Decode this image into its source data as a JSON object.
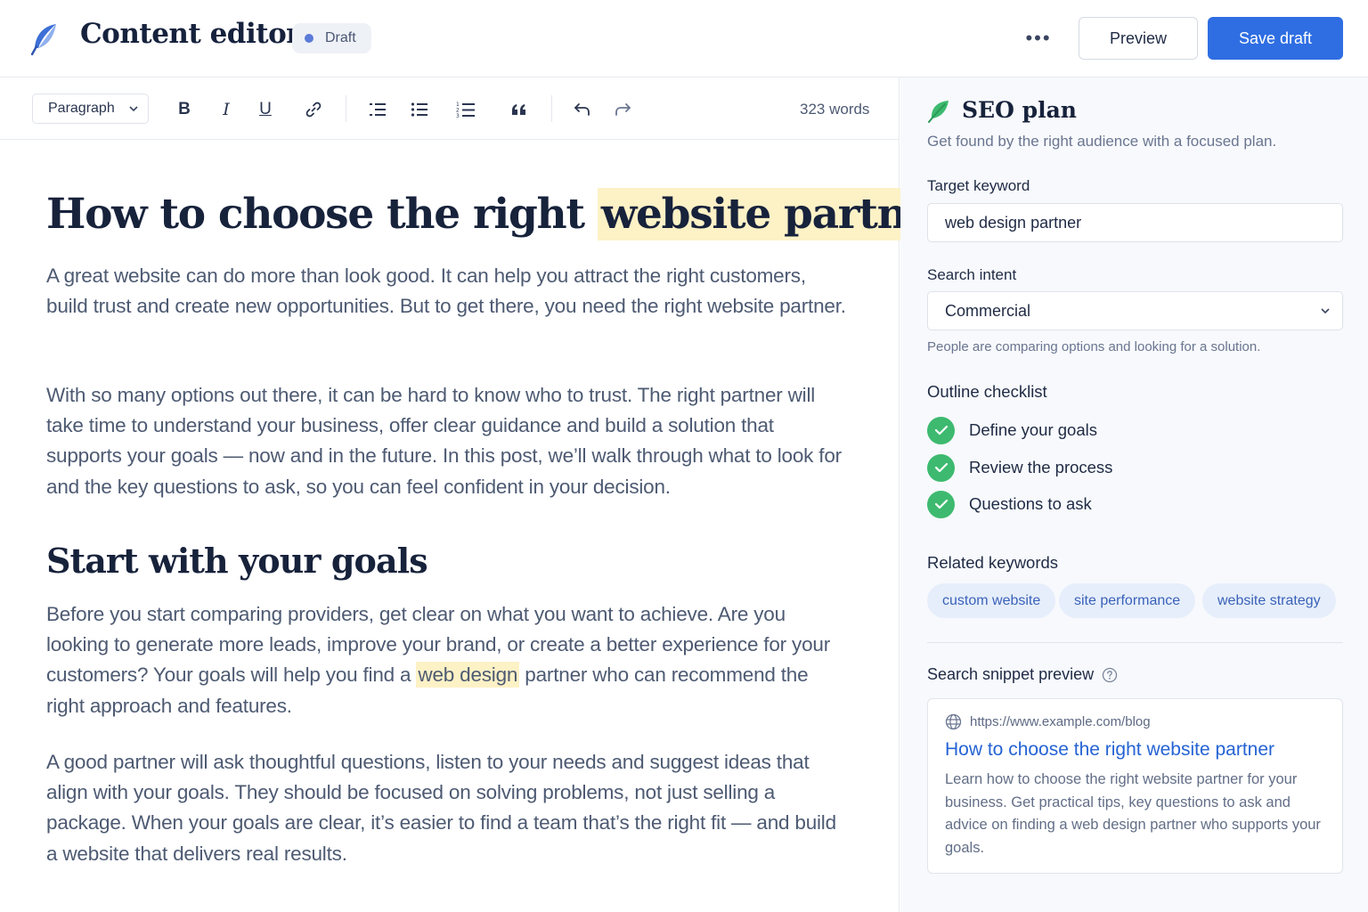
{
  "header": {
    "title": "Content editor",
    "status": "Draft",
    "more_label": "•••",
    "preview_label": "Preview",
    "save_label": "Save draft"
  },
  "toolbar": {
    "block_type": "Paragraph",
    "bold": "B",
    "italic": "I",
    "underline": "U",
    "word_count": "323 words"
  },
  "document": {
    "title_plain": "How to choose the right ",
    "title_highlight": "website partner",
    "p1": "A great website can do more than look good. It can help you attract the right customers, build trust and create new opportunities. But to get there, you need the right website partner.",
    "p2": "With so many options out there, it can be hard to know who to trust. The right partner will take time to understand your business, offer clear guidance and build a solution that supports your goals — now and in the future. In this post, we’ll walk through what to look for and the key questions to ask, so you can feel confident in your decision.",
    "h2": "Start with your goals",
    "p3_before": "Before you start comparing providers, get clear on what you want to achieve. Are you looking to generate more leads, improve your brand, or create a better experience for your customers? Your goals will help you find a ",
    "p3_highlight": "web design",
    "p3_after": " partner who can recommend the right approach and features.",
    "p4": "A good partner will ask thoughtful questions, listen to your needs and suggest ideas that align with your goals. They should be focused on solving problems, not just selling a package. When your goals are clear, it’s easier to find a team that’s the right fit — and build a website that delivers real results."
  },
  "seo": {
    "title": "SEO plan",
    "subtitle": "Get found by the right audience with a focused plan.",
    "keyword_label": "Target keyword",
    "keyword_value": "web design partner",
    "intent_label": "Search intent",
    "intent_value": "Commercial",
    "intent_hint": "People are comparing options and looking for a solution.",
    "checklist_label": "Outline checklist",
    "checklist": [
      "Define your goals",
      "Review the process",
      "Questions to ask"
    ],
    "related_label": "Related keywords",
    "related": [
      "custom website",
      "site performance",
      "website strategy"
    ],
    "snippet_label": "Search snippet preview",
    "snippet_url": "https://www.example.com/blog",
    "snippet_title": "How to choose the right website partner",
    "snippet_desc": "Learn how to choose the right website partner for your business. Get practical tips, key questions to ask and advice on finding a web design partner who supports your goals."
  },
  "colors": {
    "accent": "#2f6ee2",
    "success": "#3dba6f",
    "highlight": "#fdf1c6",
    "chip_bg": "#e6eefb"
  }
}
